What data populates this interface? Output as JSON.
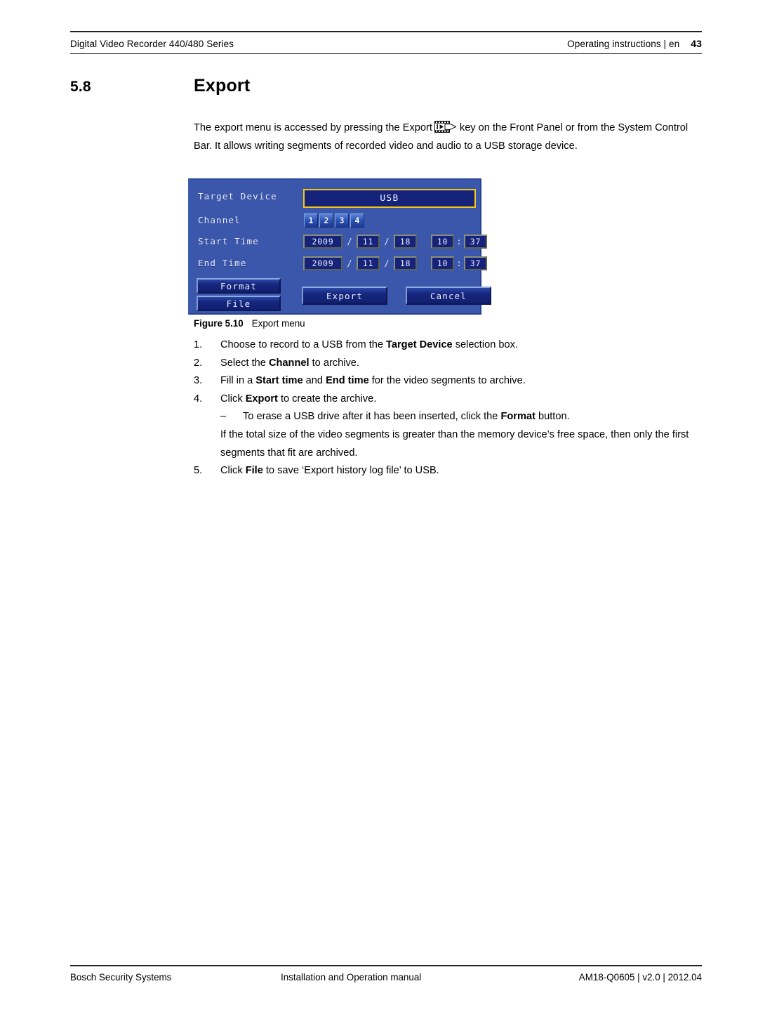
{
  "header": {
    "left": "Digital Video Recorder 440/480 Series",
    "right_text": "Operating instructions | en",
    "page_number": "43"
  },
  "section": {
    "number": "5.8",
    "title": "Export"
  },
  "paragraph": {
    "part1": "The export menu is accessed by pressing the Export",
    "icon_name": "export-film-strip-icon",
    "part2": "key on the Front Panel or from the System Control Bar. It allows writing segments of recorded video and audio to a USB storage device."
  },
  "dvr_dialog": {
    "labels": {
      "target_device": "Target Device",
      "channel": "Channel",
      "start_time": "Start Time",
      "end_time": "End Time"
    },
    "target_device_value": "USB",
    "channels": [
      "1",
      "2",
      "3",
      "4"
    ],
    "start_time": {
      "year": "2009",
      "month": "11",
      "day": "18",
      "hour": "10",
      "minute": "37",
      "date_sep": "/",
      "time_sep": ":"
    },
    "end_time": {
      "year": "2009",
      "month": "11",
      "day": "18",
      "hour": "10",
      "minute": "37",
      "date_sep": "/",
      "time_sep": ":"
    },
    "buttons": {
      "format": "Format",
      "file": "File",
      "export": "Export",
      "cancel": "Cancel"
    },
    "colors": {
      "dialog_background": "#3a57ab",
      "field_background": "#16237a",
      "selection_border": "#f5c713",
      "text": "#e9eefb"
    }
  },
  "figure": {
    "label": "Figure 5.10",
    "caption": "Export menu"
  },
  "steps": [
    {
      "number": "1.",
      "segments": [
        {
          "text": "Choose to record to a USB from the ",
          "bold": false
        },
        {
          "text": "Target Device",
          "bold": true
        },
        {
          "text": " selection box.",
          "bold": false
        }
      ]
    },
    {
      "number": "2.",
      "segments": [
        {
          "text": "Select the ",
          "bold": false
        },
        {
          "text": "Channel",
          "bold": true
        },
        {
          "text": " to archive.",
          "bold": false
        }
      ]
    },
    {
      "number": "3.",
      "segments": [
        {
          "text": "Fill in a ",
          "bold": false
        },
        {
          "text": "Start time",
          "bold": true
        },
        {
          "text": " and ",
          "bold": false
        },
        {
          "text": "End time",
          "bold": true
        },
        {
          "text": " for the video segments to archive.",
          "bold": false
        }
      ]
    },
    {
      "number": "4.",
      "segments": [
        {
          "text": "Click ",
          "bold": false
        },
        {
          "text": "Export",
          "bold": true
        },
        {
          "text": " to create the archive.",
          "bold": false
        }
      ]
    }
  ],
  "substep": {
    "dash": "–",
    "segments": [
      {
        "text": "To erase a USB drive after it has been inserted, click the ",
        "bold": false
      },
      {
        "text": "Format",
        "bold": true
      },
      {
        "text": " button.",
        "bold": false
      }
    ]
  },
  "continuation": "If the total size of the video segments is greater than the memory device’s free space, then only the first segments that fit are archived.",
  "step5": {
    "number": "5.",
    "segments": [
      {
        "text": "Click ",
        "bold": false
      },
      {
        "text": "File",
        "bold": true
      },
      {
        "text": " to save ‘Export history log file’ to USB.",
        "bold": false
      }
    ]
  },
  "footer": {
    "left": "Bosch Security Systems",
    "middle": "Installation and Operation manual",
    "right": "AM18-Q0605 | v2.0 | 2012.04"
  }
}
